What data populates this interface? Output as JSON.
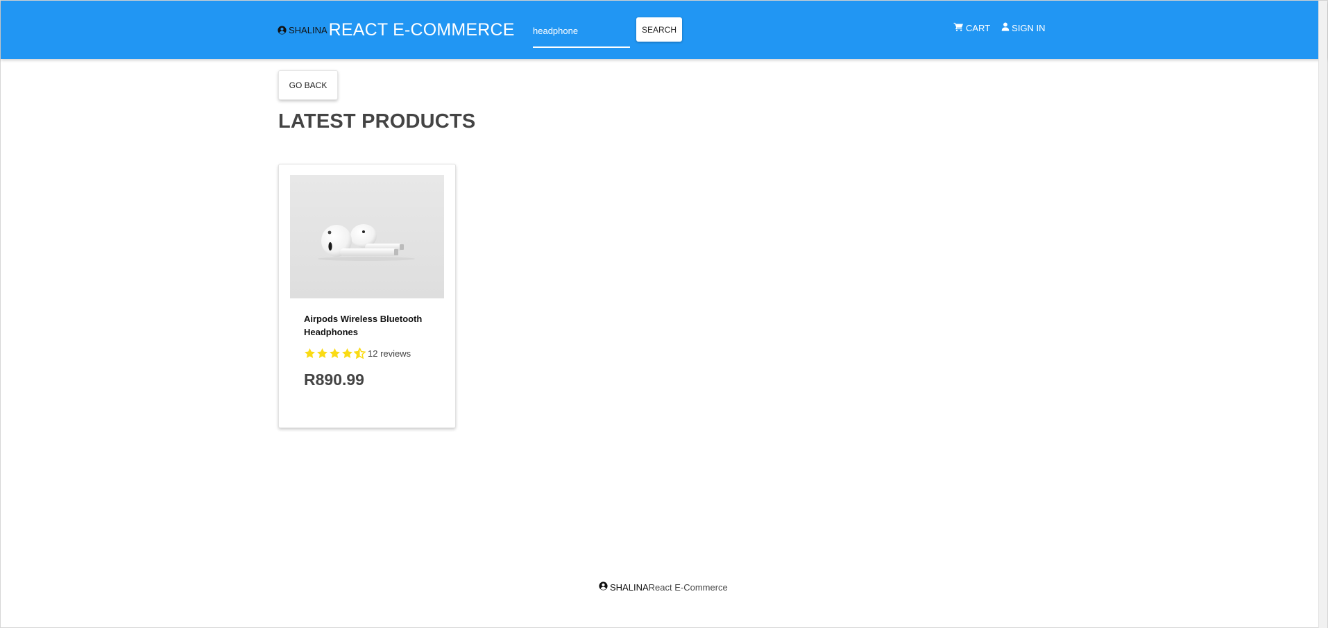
{
  "header": {
    "brand_name": "SHALINA",
    "app_title": "REACT E-COMMERCE",
    "search": {
      "value": "headphone",
      "button_label": "SEARCH"
    },
    "nav": {
      "cart_label": "CART",
      "signin_label": "SIGN IN"
    },
    "colors": {
      "navbar": "#2196f3"
    }
  },
  "main": {
    "go_back_label": "GO BACK",
    "section_title": "LATEST PRODUCTS",
    "products": [
      {
        "name": "Airpods Wireless Bluetooth Headphones",
        "rating": 4.5,
        "rating_max": 5,
        "reviews": "12 reviews",
        "price": "R890.99",
        "image_icon": "airpods-image"
      }
    ]
  },
  "footer": {
    "brand_name": "SHALINA",
    "text": "React E-Commerce"
  },
  "icons": {
    "user": "user-circle-icon",
    "cart": "cart-icon",
    "signin": "user-icon",
    "star": "star-icon",
    "star_color": "#fadb14"
  }
}
